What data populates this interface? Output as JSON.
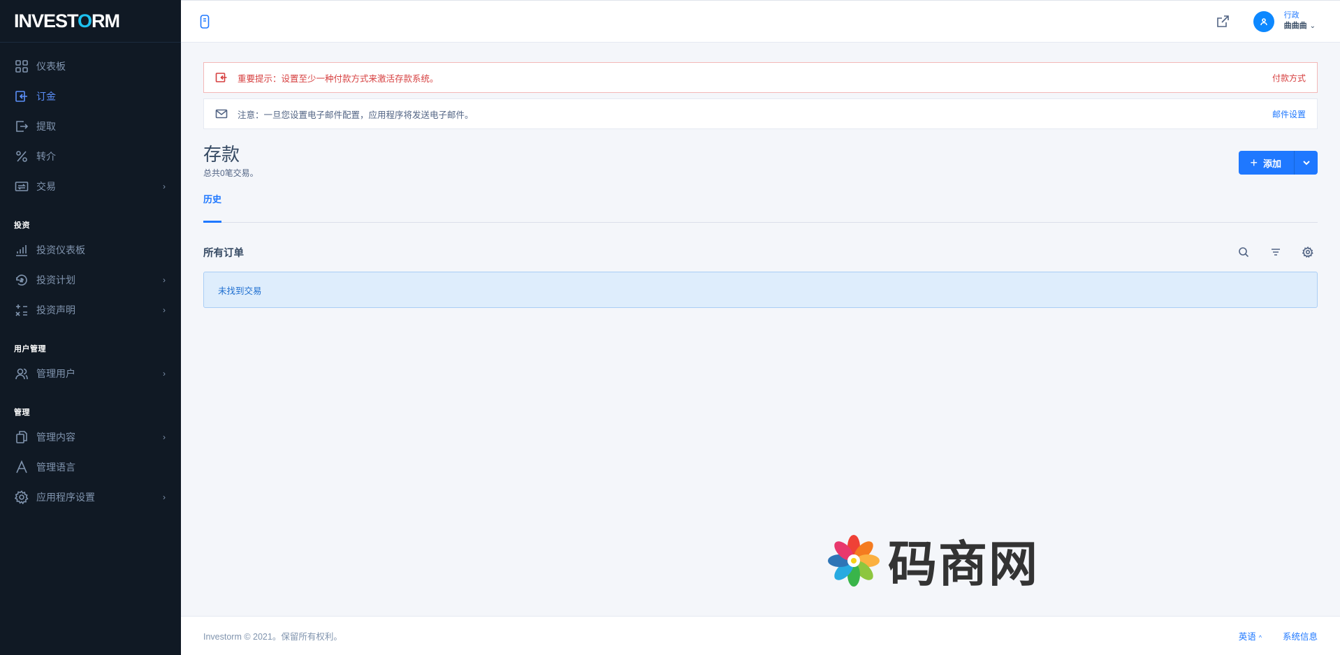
{
  "brand": {
    "logo_pre": "INVEST",
    "logo_o": "O",
    "logo_post": "RM"
  },
  "sidebar": {
    "items": [
      {
        "label": "仪表板",
        "icon": "grid-icon"
      },
      {
        "label": "订金",
        "icon": "deposit-icon"
      },
      {
        "label": "提取",
        "icon": "withdraw-icon"
      },
      {
        "label": "转介",
        "icon": "percent-icon"
      },
      {
        "label": "交易",
        "icon": "transactions-icon"
      }
    ],
    "heading_invest": "投资",
    "invest_items": [
      {
        "label": "投资仪表板",
        "icon": "chart-bars-icon"
      },
      {
        "label": "投资计划",
        "icon": "plans-icon"
      },
      {
        "label": "投资声明",
        "icon": "statement-icon"
      }
    ],
    "heading_users": "用户管理",
    "user_items": [
      {
        "label": "管理用户",
        "icon": "users-icon"
      }
    ],
    "heading_manage": "管理",
    "manage_items": [
      {
        "label": "管理内容",
        "icon": "copy-icon"
      },
      {
        "label": "管理语言",
        "icon": "language-icon"
      },
      {
        "label": "应用程序设置",
        "icon": "gear-icon"
      }
    ]
  },
  "header": {
    "user_role": "行政",
    "user_name": "曲曲曲"
  },
  "alerts": {
    "danger_message": "重要提示：设置至少一种付款方式来激活存款系统。",
    "danger_link": "付款方式",
    "info_message": "注意：一旦您设置电子邮件配置，应用程序将发送电子邮件。",
    "info_link": "邮件设置"
  },
  "page": {
    "title": "存款",
    "subtitle": "总共0笔交易。",
    "add_label": "添加",
    "tab_history": "历史",
    "section_title": "所有订单",
    "empty_message": "未找到交易"
  },
  "watermark": {
    "text": "码商网"
  },
  "footer": {
    "copyright": "Investorm © 2021。保留所有权利。",
    "language": "英语",
    "system_info": "系统信息"
  }
}
